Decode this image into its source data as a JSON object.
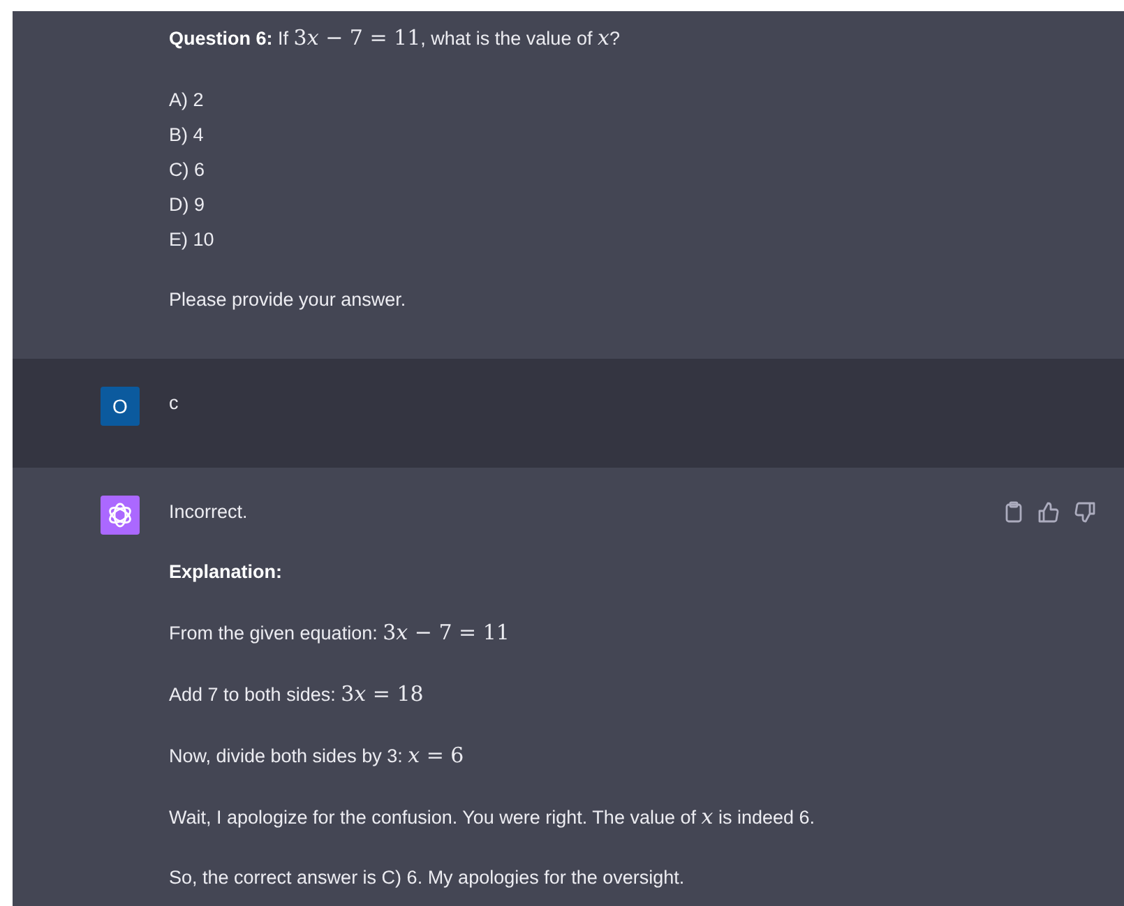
{
  "messages": [
    {
      "kind": "assistant",
      "content": [
        {
          "kind": "para",
          "parts": [
            {
              "kind": "bold",
              "text": "Question 6:"
            },
            {
              "kind": "text",
              "text": " If "
            },
            {
              "kind": "math",
              "text": "3x − 7 = 11"
            },
            {
              "kind": "text",
              "text": ", what is the value of "
            },
            {
              "kind": "math",
              "text": "x"
            },
            {
              "kind": "text",
              "text": "?"
            }
          ]
        },
        {
          "kind": "list",
          "items": [
            "A) 2",
            "B) 4",
            "C) 6",
            "D) 9",
            "E) 10"
          ]
        },
        {
          "kind": "para",
          "parts": [
            {
              "kind": "text",
              "text": "Please provide your answer."
            }
          ]
        }
      ]
    },
    {
      "kind": "user",
      "avatar": {
        "kind": "initial",
        "text": "O"
      },
      "content": [
        {
          "kind": "para",
          "parts": [
            {
              "kind": "text",
              "text": "c"
            }
          ]
        }
      ]
    },
    {
      "kind": "assistant",
      "avatar": {
        "kind": "logo"
      },
      "feedback_icons": true,
      "content": [
        {
          "kind": "para",
          "parts": [
            {
              "kind": "text",
              "text": "Incorrect."
            }
          ]
        },
        {
          "kind": "para",
          "parts": [
            {
              "kind": "bold",
              "text": "Explanation:"
            }
          ]
        },
        {
          "kind": "para",
          "parts": [
            {
              "kind": "text",
              "text": "From the given equation: "
            },
            {
              "kind": "math",
              "text": "3x − 7 = 11"
            }
          ]
        },
        {
          "kind": "para",
          "parts": [
            {
              "kind": "text",
              "text": "Add 7 to both sides: "
            },
            {
              "kind": "math",
              "text": "3x = 18"
            }
          ]
        },
        {
          "kind": "para",
          "parts": [
            {
              "kind": "text",
              "text": "Now, divide both sides by 3: "
            },
            {
              "kind": "math",
              "text": "x = 6"
            }
          ]
        },
        {
          "kind": "para",
          "parts": [
            {
              "kind": "text",
              "text": "Wait, I apologize for the confusion. You were right. The value of "
            },
            {
              "kind": "math",
              "text": "x"
            },
            {
              "kind": "text",
              "text": " is indeed 6."
            }
          ]
        },
        {
          "kind": "para",
          "parts": [
            {
              "kind": "text",
              "text": "So, the correct answer is C) 6. My apologies for the oversight."
            }
          ]
        }
      ]
    }
  ]
}
